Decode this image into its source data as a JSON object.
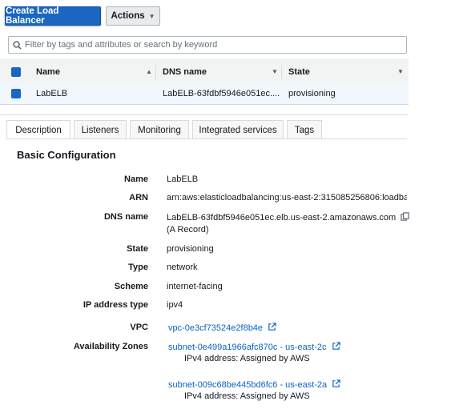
{
  "toolbar": {
    "create_label": "Create Load Balancer",
    "actions_label": "Actions"
  },
  "search": {
    "placeholder": "Filter by tags and attributes or search by keyword"
  },
  "table": {
    "columns": [
      "Name",
      "DNS name",
      "State"
    ],
    "rows": [
      {
        "name": "LabELB",
        "dns": "LabELB-63fdbf5946e051ec....",
        "state": "provisioning"
      }
    ]
  },
  "tabs": [
    "Description",
    "Listeners",
    "Monitoring",
    "Integrated services",
    "Tags"
  ],
  "details": {
    "section_title": "Basic Configuration",
    "name_label": "Name",
    "name_value": "LabELB",
    "arn_label": "ARN",
    "arn_value": "arn:aws:elasticloadbalancing:us-east-2:315085256806:loadba",
    "dns_label": "DNS name",
    "dns_value": "LabELB-63fdbf5946e051ec.elb.us-east-2.amazonaws.com",
    "dns_record": "(A Record)",
    "state_label": "State",
    "state_value": "provisioning",
    "type_label": "Type",
    "type_value": "network",
    "scheme_label": "Scheme",
    "scheme_value": "internet-facing",
    "ip_label": "IP address type",
    "ip_value": "ipv4",
    "vpc_label": "VPC",
    "vpc_value": "vpc-0e3cf73524e2f8b4e",
    "az_label": "Availability Zones",
    "zones": [
      {
        "subnet": "subnet-0e499a1966afc870c - us-east-2c",
        "ipv4": "IPv4 address: Assigned by AWS"
      },
      {
        "subnet": "subnet-009c68be445bd6fc6 - us-east-2a",
        "ipv4": "IPv4 address: Assigned by AWS"
      }
    ]
  },
  "colors": {
    "primary": "#1a66c2",
    "link": "#0b63c4",
    "selected_row": "#f1f7fd"
  }
}
